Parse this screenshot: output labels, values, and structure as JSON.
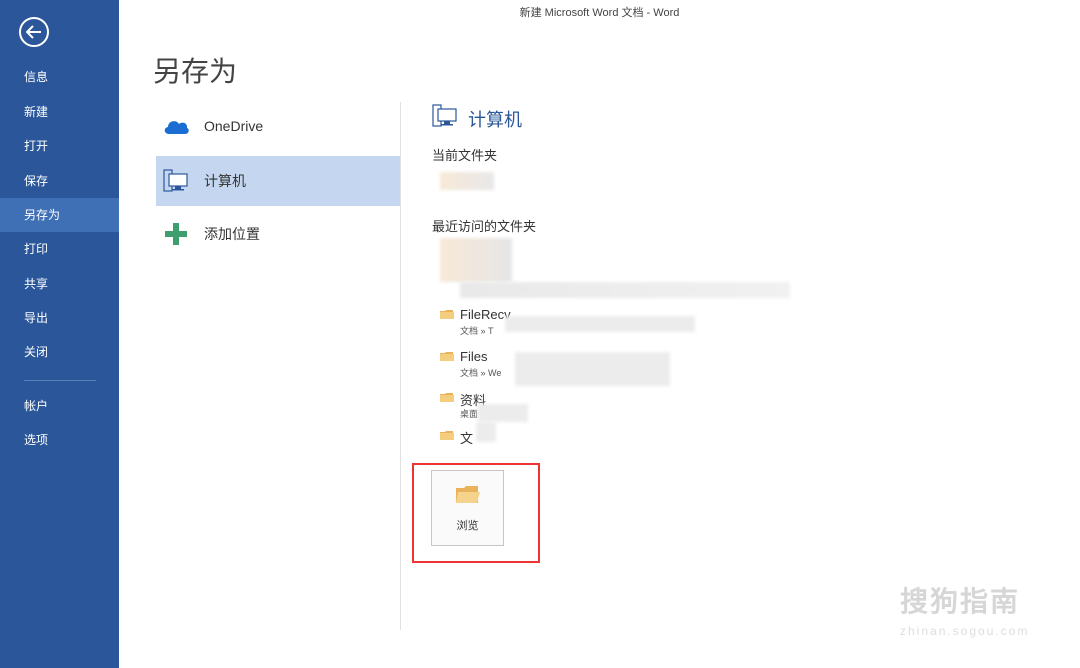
{
  "window_title": "新建 Microsoft Word 文档 - Word",
  "sidebar": {
    "items": [
      {
        "label": "信息"
      },
      {
        "label": "新建"
      },
      {
        "label": "打开"
      },
      {
        "label": "保存"
      },
      {
        "label": "另存为",
        "active": true
      },
      {
        "label": "打印"
      },
      {
        "label": "共享"
      },
      {
        "label": "导出"
      },
      {
        "label": "关闭"
      },
      {
        "label": "帐户"
      },
      {
        "label": "选项"
      }
    ]
  },
  "page_title": "另存为",
  "locations": [
    {
      "label": "OneDrive",
      "icon": "cloud-icon"
    },
    {
      "label": "计算机",
      "icon": "computer-icon",
      "selected": true
    },
    {
      "label": "添加位置",
      "icon": "plus-icon"
    }
  ],
  "computer": {
    "title": "计算机",
    "current_folder_label": "当前文件夹",
    "recent_folders_label": "最近访问的文件夹",
    "recent_folders": [
      {
        "name": "FileRecv",
        "path": "文档 » T"
      },
      {
        "name": "Files",
        "path": "文档 » We"
      },
      {
        "name": "资料",
        "path": "桌面"
      },
      {
        "name": "文",
        "path": ""
      }
    ],
    "browse_label": "浏览"
  },
  "watermark": {
    "text": "搜狗指南",
    "sub": "zhinan.sogou.com"
  },
  "colors": {
    "sidebar": "#2b579a",
    "accent": "#2b579a",
    "selected": "#c5d7f0",
    "highlight": "#e33333"
  }
}
